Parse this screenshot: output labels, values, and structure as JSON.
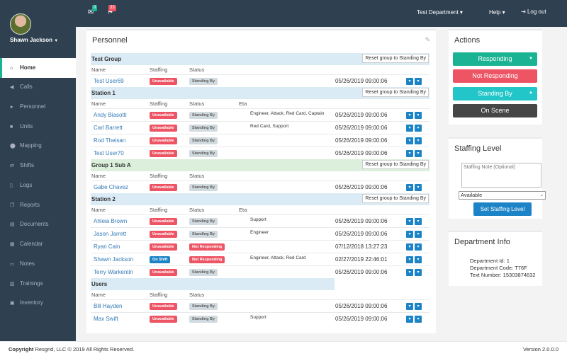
{
  "user": {
    "name": "Shawn Jackson"
  },
  "topbar": {
    "msg_count": "9",
    "alert_count": "33",
    "department": "Test Department",
    "help": "Help",
    "logout": "Log out"
  },
  "nav": [
    {
      "label": "Home",
      "icon": "home-icon"
    },
    {
      "label": "Calls",
      "icon": "bullhorn-icon"
    },
    {
      "label": "Personnel",
      "icon": "user-icon"
    },
    {
      "label": "Units",
      "icon": "truck-icon"
    },
    {
      "label": "Mapping",
      "icon": "map-marker-icon"
    },
    {
      "label": "Shifts",
      "icon": "shifts-icon"
    },
    {
      "label": "Logs",
      "icon": "file-icon"
    },
    {
      "label": "Reports",
      "icon": "copy-icon"
    },
    {
      "label": "Documents",
      "icon": "document-icon"
    },
    {
      "label": "Calendar",
      "icon": "calendar-icon"
    },
    {
      "label": "Notes",
      "icon": "note-icon"
    },
    {
      "label": "Trainings",
      "icon": "book-icon"
    },
    {
      "label": "Inventory",
      "icon": "inbox-icon"
    }
  ],
  "personnel": {
    "title": "Personnel",
    "headers": {
      "name": "Name",
      "staffing": "Staffing",
      "status": "Status",
      "eta": "Eta"
    },
    "reset": "Reset group to Standing By",
    "groups": [
      {
        "name": "Test Group",
        "eta": false,
        "members": [
          {
            "name": "Test User69",
            "staffing": "Unavailable",
            "status": "Standing By",
            "roles": "",
            "time": "05/26/2019 09:00:06"
          }
        ]
      },
      {
        "name": "Station 1",
        "eta": true,
        "members": [
          {
            "name": "Andy Biasotti",
            "staffing": "Unavailable",
            "status": "Standing By",
            "roles": "Engineer, Attack, Red Card, Captain",
            "time": "05/26/2019 09:00:06"
          },
          {
            "name": "Carl Barrett",
            "staffing": "Unavailable",
            "status": "Standing By",
            "roles": "Red Card, Support",
            "time": "05/26/2019 09:00:06"
          },
          {
            "name": "Rod Theisan",
            "staffing": "Unavailable",
            "status": "Standing By",
            "roles": "",
            "time": "05/26/2019 09:00:06"
          },
          {
            "name": "Test User70",
            "staffing": "Unavailable",
            "status": "Standing By",
            "roles": "",
            "time": "05/26/2019 09:00:06"
          }
        ]
      },
      {
        "name": "Group 1 Sub A",
        "eta": false,
        "members": [
          {
            "name": "Gabe Chavez",
            "staffing": "Unavailable",
            "status": "Standing By",
            "roles": "",
            "time": "05/26/2019 09:00:06"
          }
        ]
      },
      {
        "name": "Station 2",
        "eta": true,
        "members": [
          {
            "name": "Ahleia Brown",
            "staffing": "Unavailable",
            "status": "Standing By",
            "roles": "Support",
            "time": "05/26/2019 09:00:06"
          },
          {
            "name": "Jason Jarrett",
            "staffing": "Unavailable",
            "status": "Standing By",
            "roles": "Engineer",
            "time": "05/26/2019 09:00:06"
          },
          {
            "name": "Ryan Cain",
            "staffing": "Unavailable",
            "status": "Not Responding",
            "roles": "",
            "time": "07/12/2018 13:27:23"
          },
          {
            "name": "Shawn Jackson",
            "staffing": "On Shift",
            "status": "Not Responding",
            "roles": "Engineer, Attack, Red Card",
            "time": "02/27/2019 22:46:01"
          },
          {
            "name": "Terry Warkentin",
            "staffing": "Unavailable",
            "status": "Standing By",
            "roles": "",
            "time": "05/26/2019 09:00:06"
          }
        ]
      },
      {
        "name": "Users",
        "eta": false,
        "noreset": true,
        "members": [
          {
            "name": "Bill Hayden",
            "staffing": "Unavailable",
            "status": "Standing By",
            "roles": "",
            "time": "05/26/2019 09:00:06"
          },
          {
            "name": "Max Swift",
            "staffing": "Unavailable",
            "status": "Standing By",
            "roles": "Support",
            "time": "05/26/2019 09:00:06"
          }
        ]
      }
    ]
  },
  "actions": {
    "title": "Actions",
    "responding": "Responding",
    "not_responding": "Not Responding",
    "standing_by": "Standing By",
    "on_scene": "On Scene"
  },
  "staffing": {
    "title": "Staffing Level",
    "placeholder": "Staffing Note (Optional)",
    "selected": "Available",
    "button": "Set Staffing Level"
  },
  "dept": {
    "title": "Department Info",
    "id": "Department Id: 1",
    "code": "Department Code: T76F",
    "text": "Text Number: 15303874632"
  },
  "footer": {
    "copyright": "Copyright",
    "rest": " Resgrid, LLC © 2019 All Rights Reserved.",
    "version": "Version 2.0.0.0"
  },
  "colors": {
    "sidebar": "#2f4050",
    "unavailable": "#ed5565",
    "standing_by": "#d1dade",
    "on_shift": "#1c84c6",
    "responding": "#1ab394",
    "on_scene": "#464646",
    "standing_by_btn": "#23c6c8"
  }
}
